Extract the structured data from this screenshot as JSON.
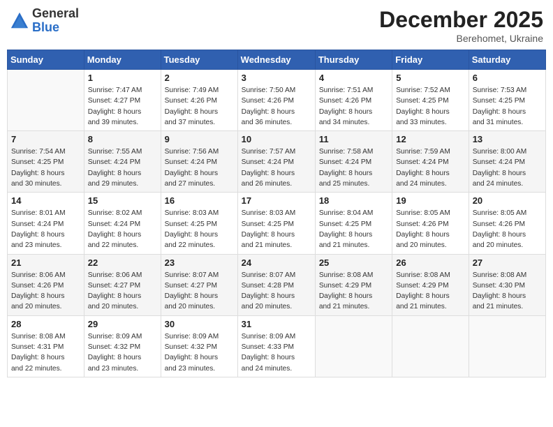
{
  "header": {
    "logo_general": "General",
    "logo_blue": "Blue",
    "month": "December 2025",
    "location": "Berehomet, Ukraine"
  },
  "weekdays": [
    "Sunday",
    "Monday",
    "Tuesday",
    "Wednesday",
    "Thursday",
    "Friday",
    "Saturday"
  ],
  "weeks": [
    [
      {
        "day": "",
        "info": ""
      },
      {
        "day": "1",
        "info": "Sunrise: 7:47 AM\nSunset: 4:27 PM\nDaylight: 8 hours\nand 39 minutes."
      },
      {
        "day": "2",
        "info": "Sunrise: 7:49 AM\nSunset: 4:26 PM\nDaylight: 8 hours\nand 37 minutes."
      },
      {
        "day": "3",
        "info": "Sunrise: 7:50 AM\nSunset: 4:26 PM\nDaylight: 8 hours\nand 36 minutes."
      },
      {
        "day": "4",
        "info": "Sunrise: 7:51 AM\nSunset: 4:26 PM\nDaylight: 8 hours\nand 34 minutes."
      },
      {
        "day": "5",
        "info": "Sunrise: 7:52 AM\nSunset: 4:25 PM\nDaylight: 8 hours\nand 33 minutes."
      },
      {
        "day": "6",
        "info": "Sunrise: 7:53 AM\nSunset: 4:25 PM\nDaylight: 8 hours\nand 31 minutes."
      }
    ],
    [
      {
        "day": "7",
        "info": "Sunrise: 7:54 AM\nSunset: 4:25 PM\nDaylight: 8 hours\nand 30 minutes."
      },
      {
        "day": "8",
        "info": "Sunrise: 7:55 AM\nSunset: 4:24 PM\nDaylight: 8 hours\nand 29 minutes."
      },
      {
        "day": "9",
        "info": "Sunrise: 7:56 AM\nSunset: 4:24 PM\nDaylight: 8 hours\nand 27 minutes."
      },
      {
        "day": "10",
        "info": "Sunrise: 7:57 AM\nSunset: 4:24 PM\nDaylight: 8 hours\nand 26 minutes."
      },
      {
        "day": "11",
        "info": "Sunrise: 7:58 AM\nSunset: 4:24 PM\nDaylight: 8 hours\nand 25 minutes."
      },
      {
        "day": "12",
        "info": "Sunrise: 7:59 AM\nSunset: 4:24 PM\nDaylight: 8 hours\nand 24 minutes."
      },
      {
        "day": "13",
        "info": "Sunrise: 8:00 AM\nSunset: 4:24 PM\nDaylight: 8 hours\nand 24 minutes."
      }
    ],
    [
      {
        "day": "14",
        "info": "Sunrise: 8:01 AM\nSunset: 4:24 PM\nDaylight: 8 hours\nand 23 minutes."
      },
      {
        "day": "15",
        "info": "Sunrise: 8:02 AM\nSunset: 4:24 PM\nDaylight: 8 hours\nand 22 minutes."
      },
      {
        "day": "16",
        "info": "Sunrise: 8:03 AM\nSunset: 4:25 PM\nDaylight: 8 hours\nand 22 minutes."
      },
      {
        "day": "17",
        "info": "Sunrise: 8:03 AM\nSunset: 4:25 PM\nDaylight: 8 hours\nand 21 minutes."
      },
      {
        "day": "18",
        "info": "Sunrise: 8:04 AM\nSunset: 4:25 PM\nDaylight: 8 hours\nand 21 minutes."
      },
      {
        "day": "19",
        "info": "Sunrise: 8:05 AM\nSunset: 4:26 PM\nDaylight: 8 hours\nand 20 minutes."
      },
      {
        "day": "20",
        "info": "Sunrise: 8:05 AM\nSunset: 4:26 PM\nDaylight: 8 hours\nand 20 minutes."
      }
    ],
    [
      {
        "day": "21",
        "info": "Sunrise: 8:06 AM\nSunset: 4:26 PM\nDaylight: 8 hours\nand 20 minutes."
      },
      {
        "day": "22",
        "info": "Sunrise: 8:06 AM\nSunset: 4:27 PM\nDaylight: 8 hours\nand 20 minutes."
      },
      {
        "day": "23",
        "info": "Sunrise: 8:07 AM\nSunset: 4:27 PM\nDaylight: 8 hours\nand 20 minutes."
      },
      {
        "day": "24",
        "info": "Sunrise: 8:07 AM\nSunset: 4:28 PM\nDaylight: 8 hours\nand 20 minutes."
      },
      {
        "day": "25",
        "info": "Sunrise: 8:08 AM\nSunset: 4:29 PM\nDaylight: 8 hours\nand 21 minutes."
      },
      {
        "day": "26",
        "info": "Sunrise: 8:08 AM\nSunset: 4:29 PM\nDaylight: 8 hours\nand 21 minutes."
      },
      {
        "day": "27",
        "info": "Sunrise: 8:08 AM\nSunset: 4:30 PM\nDaylight: 8 hours\nand 21 minutes."
      }
    ],
    [
      {
        "day": "28",
        "info": "Sunrise: 8:08 AM\nSunset: 4:31 PM\nDaylight: 8 hours\nand 22 minutes."
      },
      {
        "day": "29",
        "info": "Sunrise: 8:09 AM\nSunset: 4:32 PM\nDaylight: 8 hours\nand 23 minutes."
      },
      {
        "day": "30",
        "info": "Sunrise: 8:09 AM\nSunset: 4:32 PM\nDaylight: 8 hours\nand 23 minutes."
      },
      {
        "day": "31",
        "info": "Sunrise: 8:09 AM\nSunset: 4:33 PM\nDaylight: 8 hours\nand 24 minutes."
      },
      {
        "day": "",
        "info": ""
      },
      {
        "day": "",
        "info": ""
      },
      {
        "day": "",
        "info": ""
      }
    ]
  ]
}
